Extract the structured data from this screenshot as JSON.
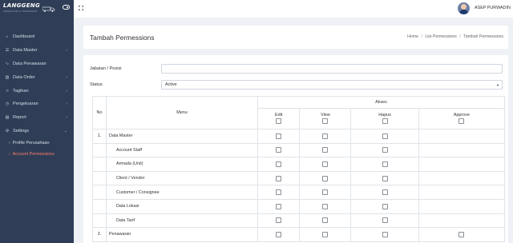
{
  "brand": {
    "name": "LANGGENG",
    "tagline": "ANGKUTAN & TRANSPORT"
  },
  "sidebar": {
    "items": [
      {
        "label": "Dashboard",
        "icon": "home-icon",
        "chevron": false
      },
      {
        "label": "Data Master",
        "icon": "list-icon",
        "chevron": true
      },
      {
        "label": "Data Penawaran",
        "icon": "pulse-icon",
        "chevron": false
      },
      {
        "label": "Data Order",
        "icon": "bar-chart-icon",
        "chevron": true
      },
      {
        "label": "Tagihan",
        "icon": "bookmark-icon",
        "chevron": true
      },
      {
        "label": "Pengeluaran",
        "icon": "clock-icon",
        "chevron": true
      },
      {
        "label": "Report",
        "icon": "file-icon",
        "chevron": true
      },
      {
        "label": "Settings",
        "icon": "gear-icon",
        "chevron": true
      }
    ],
    "subitems": [
      {
        "label": "Profile Perusahaan",
        "active": false
      },
      {
        "label": "Account Permessions",
        "active": true
      }
    ]
  },
  "topbar": {
    "username": "ASEP PURWADIN"
  },
  "header": {
    "title": "Tambah Permessions",
    "breadcrumb": [
      "Home",
      "List Permessions",
      "Tambah Permessions"
    ]
  },
  "form": {
    "jabatan_label": "Jabatan / Posisi",
    "jabatan_value": "",
    "status_label": "Status",
    "status_value": "Active"
  },
  "table": {
    "col_no": "No",
    "col_menu": "Menu",
    "col_akses": "Akses",
    "akses_cols": [
      "Edit",
      "View",
      "Hapus",
      "Approve"
    ],
    "rows": [
      {
        "no": "1.",
        "menu": "Data Master",
        "sub": false
      },
      {
        "no": "",
        "menu": "Account Staff",
        "sub": true
      },
      {
        "no": "",
        "menu": "Armada (Unit)",
        "sub": true
      },
      {
        "no": "",
        "menu": "Client / Vendor",
        "sub": true
      },
      {
        "no": "",
        "menu": "Customer / Consignee",
        "sub": true
      },
      {
        "no": "",
        "menu": "Data Lokasi",
        "sub": true
      },
      {
        "no": "",
        "menu": "Data Tarif",
        "sub": true
      },
      {
        "no": "2.",
        "menu": "Penawaran",
        "sub": false
      }
    ]
  },
  "colors": {
    "sidebar_bg": "#2f3e56",
    "active_sub": "#ff7a6b",
    "content_bg": "#eef1f5"
  }
}
